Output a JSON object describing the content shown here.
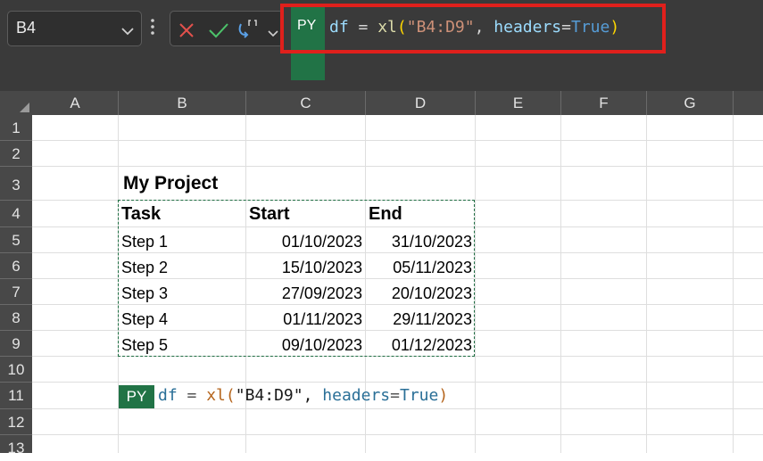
{
  "name_box": {
    "value": "B4"
  },
  "formula_bar": {
    "badge": "PY",
    "tokens": [
      {
        "text": "df",
        "color": "#9cdcfe"
      },
      {
        "text": " = ",
        "color": "#d4d4d4"
      },
      {
        "text": "xl",
        "color": "#dcdcaa"
      },
      {
        "text": "(",
        "color": "#ffd700"
      },
      {
        "text": "\"B4:D9\"",
        "color": "#ce9178"
      },
      {
        "text": ", ",
        "color": "#d4d4d4"
      },
      {
        "text": "headers",
        "color": "#9cdcfe"
      },
      {
        "text": "=",
        "color": "#d4d4d4"
      },
      {
        "text": "True",
        "color": "#569cd6"
      },
      {
        "text": ")",
        "color": "#ffd700"
      }
    ]
  },
  "columns": [
    "A",
    "B",
    "C",
    "D",
    "E",
    "F",
    "G"
  ],
  "rows": [
    "1",
    "2",
    "3",
    "4",
    "5",
    "6",
    "7",
    "8",
    "9",
    "10",
    "11",
    "12",
    "13"
  ],
  "sheet": {
    "title": "My Project",
    "headers": [
      "Task",
      "Start",
      "End"
    ],
    "tasks": [
      {
        "task": "Step 1",
        "start": "01/10/2023",
        "end": "31/10/2023"
      },
      {
        "task": "Step 2",
        "start": "15/10/2023",
        "end": "05/11/2023"
      },
      {
        "task": "Step 3",
        "start": "27/09/2023",
        "end": "20/10/2023"
      },
      {
        "task": "Step 4",
        "start": "01/11/2023",
        "end": "29/11/2023"
      },
      {
        "task": "Step 5",
        "start": "09/10/2023",
        "end": "01/12/2023"
      }
    ]
  },
  "python_cell": {
    "badge": "PY",
    "tokens": [
      {
        "text": "df",
        "color": "#2a6f97"
      },
      {
        "text": " = ",
        "color": "#555555"
      },
      {
        "text": "xl",
        "color": "#b5651d"
      },
      {
        "text": "(",
        "color": "#b5651d"
      },
      {
        "text": "\"B4:D9\"",
        "color": "#1a1a1a"
      },
      {
        "text": ", ",
        "color": "#1a1a1a"
      },
      {
        "text": "headers",
        "color": "#2a6f97"
      },
      {
        "text": "=",
        "color": "#555555"
      },
      {
        "text": "True",
        "color": "#2a6f97"
      },
      {
        "text": ")",
        "color": "#b5651d"
      }
    ]
  },
  "colors": {
    "accent": "#217346",
    "highlight": "#e0201c"
  }
}
